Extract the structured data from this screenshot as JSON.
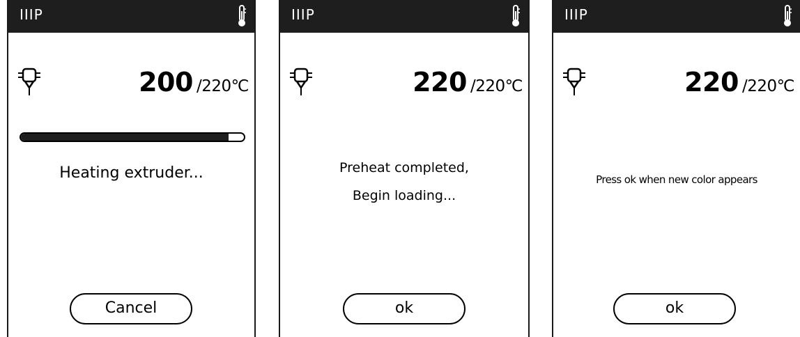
{
  "screens": [
    {
      "brand": "IIIP",
      "temp_current": "200",
      "temp_target": "/220℃",
      "progress": 0.93,
      "message": "Heating extruder...",
      "button_label": "Cancel"
    },
    {
      "brand": "IIIP",
      "temp_current": "220",
      "temp_target": "/220℃",
      "message_line1": "Preheat completed,",
      "message_line2": "Begin loading...",
      "button_label": "ok"
    },
    {
      "brand": "IIIP",
      "temp_current": "220",
      "temp_target": "/220℃",
      "message": "Press ok when new color appears",
      "button_label": "ok"
    }
  ],
  "icons": {
    "top_right": "thermometer-icon",
    "extruder": "extruder-nozzle-icon"
  },
  "colors": {
    "topbar": "#1e1e1e",
    "text": "#000000",
    "background": "#ffffff"
  }
}
